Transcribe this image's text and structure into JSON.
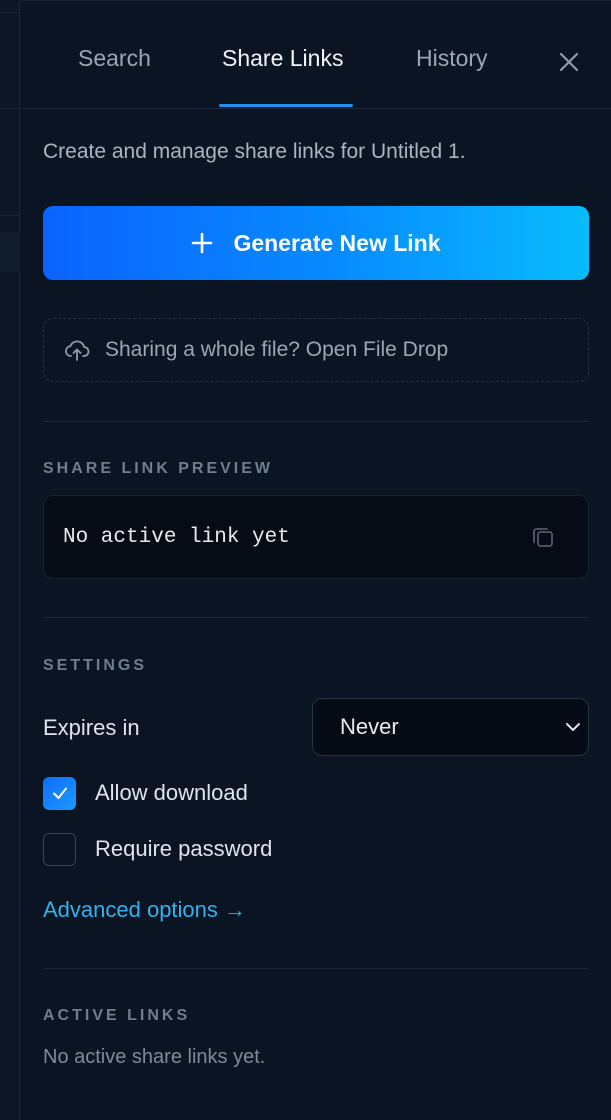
{
  "tabs": [
    {
      "label": "Search",
      "active": false
    },
    {
      "label": "Share Links",
      "active": true
    },
    {
      "label": "History",
      "active": false
    }
  ],
  "description": "Create and manage share links for Untitled 1.",
  "generate_button": {
    "label": "Generate New Link",
    "icon": "plus-icon"
  },
  "file_drop": {
    "label": "Sharing a whole file? Open File Drop",
    "icon": "cloud-upload-icon"
  },
  "preview": {
    "heading": "SHARE LINK PREVIEW",
    "value": "No active link yet",
    "icon": "copy-icon"
  },
  "settings": {
    "heading": "SETTINGS",
    "expires_label": "Expires in",
    "expires_value": "Never",
    "allow_download": {
      "label": "Allow download",
      "checked": true
    },
    "require_password": {
      "label": "Require password",
      "checked": false
    },
    "advanced_link": "Advanced options →"
  },
  "active_links": {
    "heading": "ACTIVE LINKS",
    "empty": "No active share links yet."
  },
  "colors": {
    "background": "#0b1422",
    "accent": "#1f8ff0",
    "link": "#2fb2ee",
    "gradient_start": "#0b63ff",
    "gradient_end": "#08bcfc"
  }
}
